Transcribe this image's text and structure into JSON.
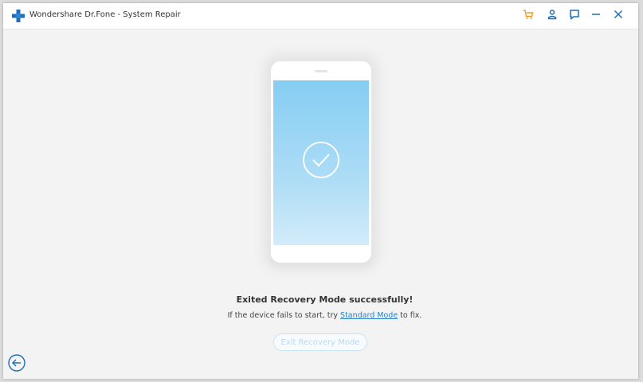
{
  "titlebar": {
    "title": "Wondershare Dr.Fone - System Repair",
    "logo_icon": "plus-cross-logo",
    "buttons": [
      {
        "name": "cart-icon"
      },
      {
        "name": "account-icon"
      },
      {
        "name": "feedback-icon"
      },
      {
        "name": "minimize-icon"
      },
      {
        "name": "close-icon"
      }
    ]
  },
  "main": {
    "headline": "Exited Recovery Mode successfully!",
    "sub_prefix": "If the device fails to start, try ",
    "sub_link": "Standard Mode",
    "sub_suffix": " to fix.",
    "exit_button": "Exit Recovery Mode",
    "exit_button_state": "disabled"
  },
  "footer": {
    "back_icon": "back-arrow-icon"
  },
  "colors": {
    "accent": "#1f6fb8",
    "link": "#2a7fc7",
    "cart": "#f29a20",
    "screen_top": "#85cdf3",
    "screen_bottom": "#d3ecfa"
  }
}
